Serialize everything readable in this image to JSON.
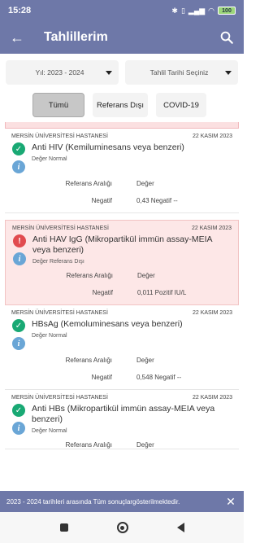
{
  "status_bar": {
    "time": "15:28",
    "icons": [
      "bluetooth-icon",
      "vibrate-icon",
      "signal-icon",
      "wifi-icon"
    ],
    "battery": "100"
  },
  "app_bar": {
    "title": "Tahlillerim"
  },
  "filters": {
    "year": "Yıl: 2023 - 2024",
    "date": "Tahlil Tarihi Seçiniz"
  },
  "tabs": [
    "Tümü",
    "Referans Dışı",
    "COVID-19"
  ],
  "results": [
    {
      "hospital": "MERSİN ÜNİVERSİTESİ HASTANESİ",
      "date": "22 KASIM 2023",
      "name": "Anti HIV (Kemiluminesans veya benzeri)",
      "status": "Değer Normal",
      "range_label": "Referans Aralığı",
      "value_label": "Değer",
      "range": "Negatif",
      "value": "0,43 Negatif --",
      "alert": false
    },
    {
      "hospital": "MERSİN ÜNİVERSİTESİ HASTANESİ",
      "date": "22 KASIM 2023",
      "name": "Anti HAV IgG (Mikropartikül immün assay-MEIA veya benzeri)",
      "status": "Değer Referans Dışı",
      "range_label": "Referans Aralığı",
      "value_label": "Değer",
      "range": "Negatif",
      "value": "0,011 Pozitif IU/L",
      "alert": true
    },
    {
      "hospital": "MERSİN ÜNİVERSİTESİ HASTANESİ",
      "date": "22 KASIM 2023",
      "name": "HBsAg (Kemoluminesans veya benzeri)",
      "status": "Değer Normal",
      "range_label": "Referans Aralığı",
      "value_label": "Değer",
      "range": "Negatif",
      "value": "0,548 Negatif --",
      "alert": false
    },
    {
      "hospital": "MERSİN ÜNİVERSİTESİ HASTANESİ",
      "date": "22 KASIM 2023",
      "name": "Anti HBs (Mikropartikül immün assay-MEIA veya benzeri)",
      "status": "Değer Normal",
      "range_label": "Referans Aralığı",
      "value_label": "Değer",
      "alert": false
    }
  ],
  "snackbar": {
    "message": "2023 - 2024 tarihleri arasında Tüm sonuçlargösterilmektedir."
  },
  "colors": {
    "primary": "#6e78a8",
    "ok": "#19a974",
    "warn": "#e14b4f",
    "info": "#6aa6d6",
    "alert_bg": "#fde7e7"
  }
}
